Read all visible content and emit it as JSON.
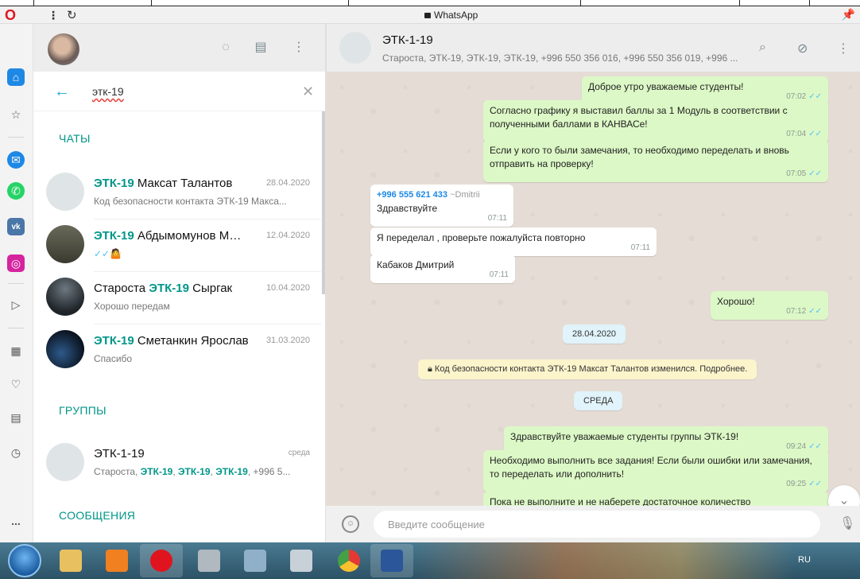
{
  "browser": {
    "title": "WhatsApp",
    "menu_icon": "kebab-icon",
    "reload_icon": "reload-icon"
  },
  "opera_sidebar": {
    "items": [
      "home-icon",
      "speed-dial-icon",
      "messenger-icon",
      "whatsapp-icon",
      "vk-icon",
      "instagram-icon",
      "flow-icon",
      "extensions-icon",
      "heart-icon",
      "history-icon",
      "clock-icon"
    ],
    "more_label": "..."
  },
  "left_pane": {
    "search": {
      "value": "этк-19"
    },
    "sections": {
      "chats": "ЧАТЫ",
      "groups": "ГРУППЫ",
      "messages": "СООБЩЕНИЯ"
    },
    "chats": [
      {
        "highlight": "ЭТК-19",
        "name_rest": " Максат Талантов",
        "date": "28.04.2020",
        "preview": "Код безопасности контакта ЭТК-19 Макса..."
      },
      {
        "highlight": "ЭТК-19",
        "name_rest": " Абдымомунов Ма...",
        "date": "12.04.2020",
        "preview": "✓✓🤷"
      },
      {
        "name_prefix": "Староста ",
        "highlight": "ЭТК-19",
        "name_rest": " Сыргак",
        "date": "10.04.2020",
        "preview": "Хорошо передам"
      },
      {
        "highlight": "ЭТК-19",
        "name_rest": " Сметанкин Ярослав",
        "date": "31.03.2020",
        "preview": "Спасибо"
      }
    ],
    "group": {
      "name": "ЭТК-1-19",
      "date": "среда",
      "preview_start": "Староста, ",
      "preview_hl1": "ЭТК-19",
      "preview_sep1": ", ",
      "preview_hl2": "ЭТК-19",
      "preview_sep2": ", ",
      "preview_hl3": "ЭТК-19",
      "preview_end": ", +996 5..."
    }
  },
  "chat": {
    "title": "ЭТК-1-19",
    "members": "Староста, ЭТК-19, ЭТК-19, ЭТК-19, +996 550 356 016, +996 550 356 019, +996 ...",
    "messages": [
      {
        "dir": "out",
        "text": "Доброе утро уважаемые студенты!",
        "time": "07:02"
      },
      {
        "dir": "out",
        "text": "Согласно графику я выставил баллы за 1 Модуль в соответствии с полученными баллами в КАНВАСе!",
        "time": "07:04"
      },
      {
        "dir": "out",
        "text": "Если у кого то были замечания, то необходимо переделать и вновь отправить на проверку!",
        "time": "07:05"
      },
      {
        "dir": "in",
        "sender": "+996 555 621 433",
        "sender_name": "~Dmitrii",
        "text": "Здравствуйте",
        "time": "07:11"
      },
      {
        "dir": "in",
        "text": "Я переделал , проверьте пожалуйста повторно",
        "time": "07:11"
      },
      {
        "dir": "in",
        "text": "Кабаков Дмитрий",
        "time": "07:11"
      },
      {
        "dir": "out",
        "text": "Хорошо!",
        "time": "07:12"
      },
      {
        "dir": "out",
        "text": "Здравствуйте уважаемые студенты группы ЭТК-19!",
        "time": "09:24"
      },
      {
        "dir": "out",
        "text": "Необходимо выполнить все задания! Если были ошибки или замечания, то переделать или дополнить!",
        "time": "09:25"
      },
      {
        "dir": "out",
        "text": "Пока не выполните и не наберете достаточное количество"
      }
    ],
    "date_pill": "28.04.2020",
    "security_notice": "Код безопасности контакта ЭТК-19 Максат Талантов изменился. Подробнее.",
    "day_pill": "СРЕДА",
    "compose_placeholder": "Введите сообщение"
  },
  "taskbar": {
    "lang": "RU",
    "apps": [
      "explorer-icon",
      "media-player-icon",
      "opera-icon",
      "paint-icon",
      "calculator-icon",
      "notes-icon",
      "chrome-icon",
      "word-icon"
    ]
  }
}
